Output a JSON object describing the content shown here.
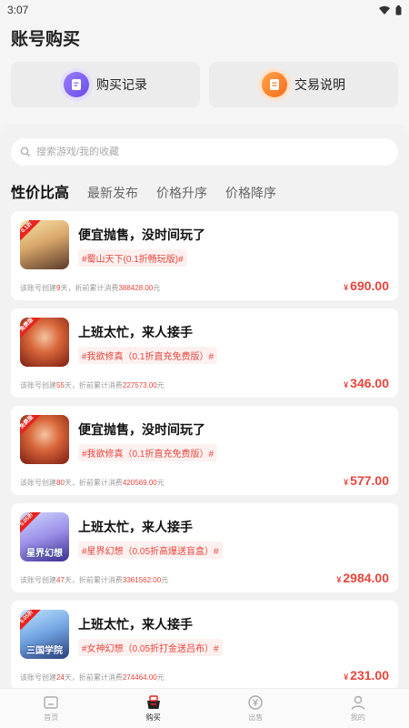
{
  "status_bar": {
    "time": "3:07"
  },
  "page": {
    "title": "账号购买"
  },
  "quick_actions": [
    {
      "label": "购买记录",
      "icon": "clipboard-icon",
      "color": "#7c5cf0"
    },
    {
      "label": "交易说明",
      "icon": "document-icon",
      "color": "#ff7a22"
    }
  ],
  "search": {
    "placeholder": "搜索游戏/我的收藏"
  },
  "tabs": [
    {
      "label": "性价比高",
      "active": true
    },
    {
      "label": "最新发布",
      "active": false
    },
    {
      "label": "价格升序",
      "active": false
    },
    {
      "label": "价格降序",
      "active": false
    }
  ],
  "listings": [
    {
      "title": "便宜抛售，没时间玩了",
      "tag": "#蜀山天下(0.1折畅玩版)#",
      "meta_prefix": "该账号创建",
      "days": "9",
      "meta_mid": "天，折前累计消费",
      "spent": "388428.00",
      "meta_suffix": "元",
      "price_symbol": "¥",
      "price": "690.00",
      "badge": "0.1折",
      "thumb_text": ""
    },
    {
      "title": "上班太忙，来人接手",
      "tag": "#我欲修真（0.1折直充免费版）#",
      "meta_prefix": "该账号创建",
      "days": "55",
      "meta_mid": "天，折前累计消费",
      "spent": "227573.00",
      "meta_suffix": "元",
      "price_symbol": "¥",
      "price": "346.00",
      "badge": "免费版",
      "thumb_text": ""
    },
    {
      "title": "便宜抛售，没时间玩了",
      "tag": "#我欲修真（0.1折直充免费版）#",
      "meta_prefix": "该账号创建",
      "days": "80",
      "meta_mid": "天，折前累计消费",
      "spent": "420569.00",
      "meta_suffix": "元",
      "price_symbol": "¥",
      "price": "577.00",
      "badge": "免费版",
      "thumb_text": ""
    },
    {
      "title": "上班太忙，来人接手",
      "tag": "#星界幻想（0.05折高爆送盲盒）#",
      "meta_prefix": "该账号创建",
      "days": "47",
      "meta_mid": "天，折前累计消费",
      "spent": "3361562.00",
      "meta_suffix": "元",
      "price_symbol": "¥",
      "price": "2984.00",
      "badge": "0.05折",
      "thumb_text": "星界幻想"
    },
    {
      "title": "上班太忙，来人接手",
      "tag": "#女神幻想（0.05折打金送吕布）#",
      "meta_prefix": "该账号创建",
      "days": "24",
      "meta_mid": "天，折前累计消费",
      "spent": "274464.00",
      "meta_suffix": "元",
      "price_symbol": "¥",
      "price": "231.00",
      "badge": "0.05折",
      "thumb_text": "三国学院"
    }
  ],
  "bottom_nav": [
    {
      "label": "首页",
      "icon": "home-icon",
      "active": false
    },
    {
      "label": "购买",
      "icon": "basket-icon",
      "active": true
    },
    {
      "label": "出售",
      "icon": "yen-coin-icon",
      "active": false
    },
    {
      "label": "我的",
      "icon": "user-icon",
      "active": false
    }
  ],
  "colors": {
    "accent": "#e8453c",
    "background": "#f5f5f5"
  }
}
